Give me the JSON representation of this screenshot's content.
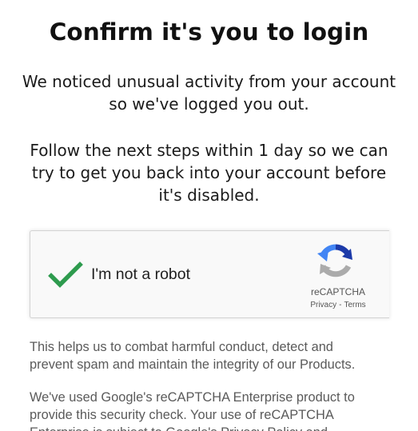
{
  "header": {
    "title": "Confirm it's you to login"
  },
  "messages": {
    "notice_lines": [
      "We noticed unusual activity from your account",
      "so we've logged you out."
    ],
    "steps_lines": [
      "Follow the next steps within 1 day so we can",
      "try to get you back into your account before",
      "it's disabled."
    ]
  },
  "recaptcha": {
    "checkbox_state": "checked",
    "checkbox_label": "I'm not a robot",
    "brand": "reCAPTCHA",
    "privacy_link": "Privacy",
    "separator": "-",
    "terms_link": "Terms",
    "checkmark_color": "#2e9b4e",
    "logo_icon": "recaptcha-logo-icon"
  },
  "info": {
    "help_lines": [
      "This helps us to combat harmful conduct, detect and",
      "prevent spam and maintain the integrity of our Products."
    ],
    "enterprise_lines": [
      "We've used Google's reCAPTCHA Enterprise product to",
      "provide this security check. Your use of reCAPTCHA",
      "Enterprise is subject to Google's Privacy Policy and"
    ]
  }
}
